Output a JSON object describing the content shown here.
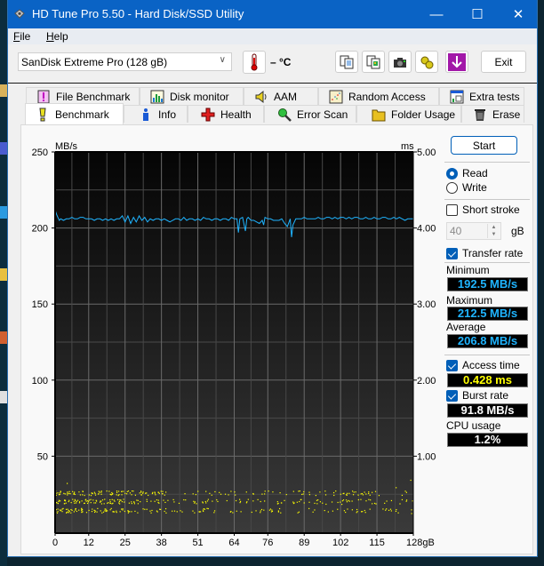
{
  "window": {
    "title": "HD Tune Pro 5.50 - Hard Disk/SSD Utility",
    "controls": {
      "minimize": "—",
      "maximize": "☐",
      "close": "✕"
    }
  },
  "menu": [
    {
      "label": "File",
      "accel": "F",
      "rest": "ile"
    },
    {
      "label": "Help",
      "accel": "H",
      "rest": "elp"
    }
  ],
  "toolbar": {
    "drive": "SanDisk Extreme Pro (128 gB)",
    "temperature": "– °C",
    "icons": [
      "copy-text-icon",
      "copy-screenshot-icon",
      "camera-icon",
      "options-icon",
      "save-icon"
    ],
    "exit_label": "Exit"
  },
  "tabs": {
    "row1": [
      {
        "label": "File Benchmark",
        "icon": "file-benchmark-icon"
      },
      {
        "label": "Disk monitor",
        "icon": "disk-monitor-icon"
      },
      {
        "label": "AAM",
        "icon": "speaker-icon"
      },
      {
        "label": "Random Access",
        "icon": "random-access-icon"
      },
      {
        "label": "Extra tests",
        "icon": "extra-tests-icon"
      }
    ],
    "row2": [
      {
        "label": "Benchmark",
        "icon": "benchmark-icon",
        "active": true
      },
      {
        "label": "Info",
        "icon": "info-icon"
      },
      {
        "label": "Health",
        "icon": "health-icon"
      },
      {
        "label": "Error Scan",
        "icon": "magnifier-icon"
      },
      {
        "label": "Folder Usage",
        "icon": "folder-icon"
      },
      {
        "label": "Erase",
        "icon": "trash-icon"
      }
    ]
  },
  "side": {
    "start_label": "Start",
    "mode": {
      "read": "Read",
      "write": "Write",
      "selected": "Read"
    },
    "short_stroke": {
      "label": "Short stroke",
      "checked": false,
      "value": "40",
      "unit": "gB"
    },
    "transfer_rate": {
      "label": "Transfer rate",
      "checked": true
    },
    "minimum": {
      "label": "Minimum",
      "value": "192.5 MB/s"
    },
    "maximum": {
      "label": "Maximum",
      "value": "212.5 MB/s"
    },
    "average": {
      "label": "Average",
      "value": "206.8 MB/s"
    },
    "access_time": {
      "label": "Access time",
      "checked": true,
      "value": "0.428 ms"
    },
    "burst_rate": {
      "label": "Burst rate",
      "checked": true,
      "value": "91.8 MB/s"
    },
    "cpu_usage": {
      "label": "CPU usage",
      "value": "1.2%"
    }
  },
  "colors": {
    "transfer_line": "#1fb4ff",
    "access_dots": "#ffff00",
    "title_bar": "#0a63c5",
    "accent": "#005fb8"
  },
  "chart_data": {
    "type": "line",
    "title": "",
    "ylabel_left": "MB/s",
    "ylabel_right": "ms",
    "xlabel": "gB",
    "xlim": [
      0,
      128
    ],
    "ylim_left": [
      0,
      250
    ],
    "ylim_right": [
      0,
      5
    ],
    "x_ticks": [
      "0",
      "12",
      "25",
      "38",
      "51",
      "64",
      "76",
      "89",
      "102",
      "115",
      "128gB"
    ],
    "y_ticks_left": [
      "50",
      "100",
      "150",
      "200",
      "250"
    ],
    "y_ticks_right": [
      "1.00",
      "2.00",
      "3.00",
      "4.00",
      "5.00"
    ],
    "grid": true,
    "series": [
      {
        "name": "Transfer rate (MB/s)",
        "axis": "left",
        "x": [
          0,
          0.5,
          1,
          1.5,
          2,
          3,
          4,
          5,
          6,
          7,
          8,
          9,
          10,
          11,
          12,
          13,
          14,
          15,
          16,
          17,
          18,
          19,
          20,
          21,
          22,
          23,
          24,
          25,
          26,
          27,
          28,
          29,
          30,
          31,
          32,
          33,
          34,
          35,
          36,
          37,
          38,
          39,
          40,
          41,
          42,
          43,
          44,
          45,
          46,
          47,
          48,
          49,
          50,
          51,
          52,
          53,
          54,
          55,
          56,
          57,
          58,
          59,
          60,
          61,
          62,
          63,
          64,
          65,
          65.5,
          66,
          67,
          68,
          68.5,
          69,
          70,
          71,
          72,
          73,
          74,
          74.5,
          75,
          76,
          77,
          78,
          79,
          80,
          81,
          82,
          83,
          84,
          84.5,
          85,
          86,
          87,
          88,
          89,
          90,
          91,
          92,
          93,
          94,
          95,
          96,
          97,
          98,
          99,
          100,
          101,
          102,
          103,
          104,
          105,
          106,
          107,
          108,
          109,
          110,
          111,
          112,
          113,
          114,
          115,
          116,
          117,
          118,
          119,
          120,
          121,
          122,
          123,
          124,
          125,
          126,
          127,
          128
        ],
        "values": [
          212,
          209,
          207,
          205,
          206,
          205,
          206,
          206,
          207,
          206,
          206,
          207,
          207,
          206,
          206,
          206,
          205,
          206,
          206,
          205,
          206,
          205,
          206,
          205,
          206,
          206,
          208,
          204,
          208,
          203,
          207,
          204,
          208,
          205,
          207,
          204,
          206,
          205,
          206,
          206,
          205,
          206,
          205,
          204,
          205,
          206,
          206,
          205,
          207,
          205,
          206,
          206,
          205,
          206,
          205,
          207,
          206,
          206,
          205,
          206,
          206,
          205,
          206,
          206,
          205,
          207,
          206,
          206,
          197,
          206,
          207,
          198,
          206,
          207,
          205,
          205,
          204,
          203,
          205,
          202,
          207,
          206,
          206,
          205,
          205,
          205,
          206,
          203,
          201,
          206,
          194,
          202,
          206,
          206,
          206,
          207,
          206,
          206,
          206,
          206,
          207,
          206,
          206,
          207,
          207,
          206,
          207,
          206,
          207,
          207,
          206,
          207,
          206,
          207,
          207,
          206,
          206,
          207,
          206,
          206,
          207,
          206,
          206,
          207,
          207,
          206,
          206,
          207,
          206,
          207,
          206,
          205,
          206,
          206,
          206
        ]
      },
      {
        "name": "Access time (ms)",
        "axis": "right",
        "style": "scatter",
        "bands_ms": [
          0.29,
          0.41,
          0.52
        ],
        "range_ms": [
          0.25,
          0.7
        ]
      }
    ]
  }
}
